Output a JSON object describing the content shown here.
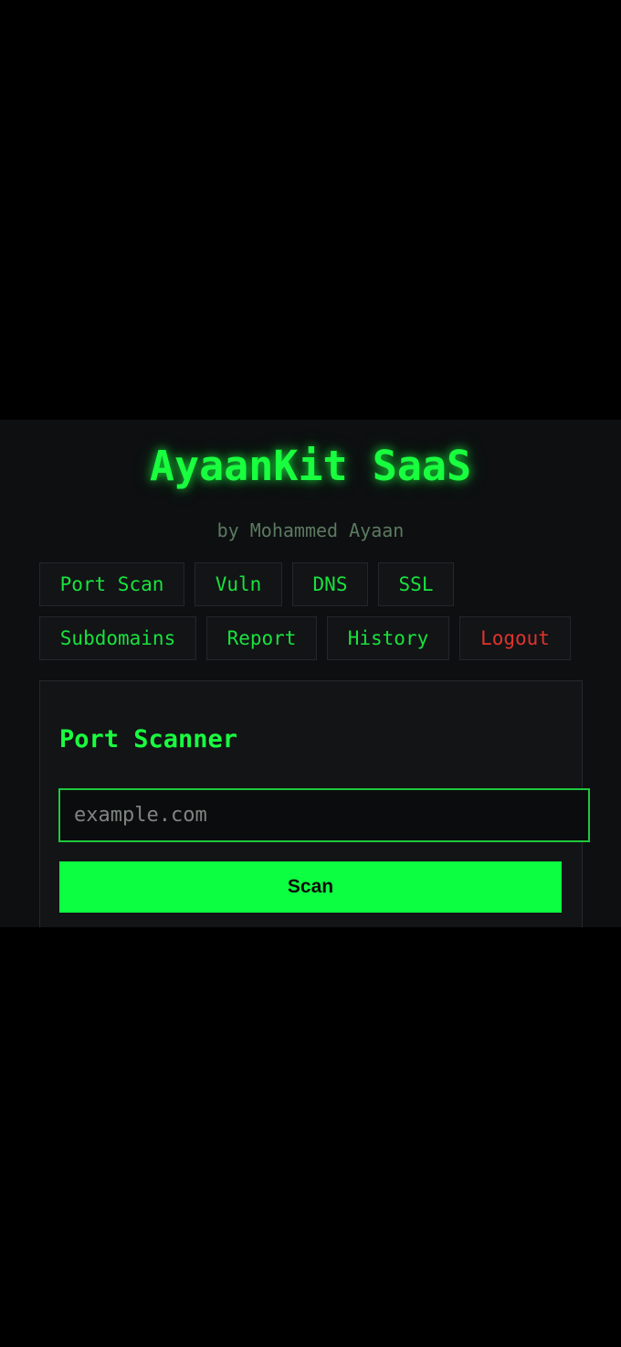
{
  "header": {
    "title": "AyaanKit SaaS",
    "subtitle": "by Mohammed Ayaan"
  },
  "nav": {
    "items": [
      {
        "label": "Port Scan"
      },
      {
        "label": "Vuln"
      },
      {
        "label": "DNS"
      },
      {
        "label": "SSL"
      },
      {
        "label": "Subdomains"
      },
      {
        "label": "Report"
      },
      {
        "label": "History"
      },
      {
        "label": "Logout"
      }
    ]
  },
  "scanner": {
    "title": "Port Scanner",
    "input_value": "",
    "input_placeholder": "example.com",
    "scan_label": "Scan"
  },
  "colors": {
    "background": "#000000",
    "panel": "#0d0f11",
    "accent_green": "#19ff3f",
    "button_green": "#0dff42",
    "logout_red": "#e0332e"
  }
}
